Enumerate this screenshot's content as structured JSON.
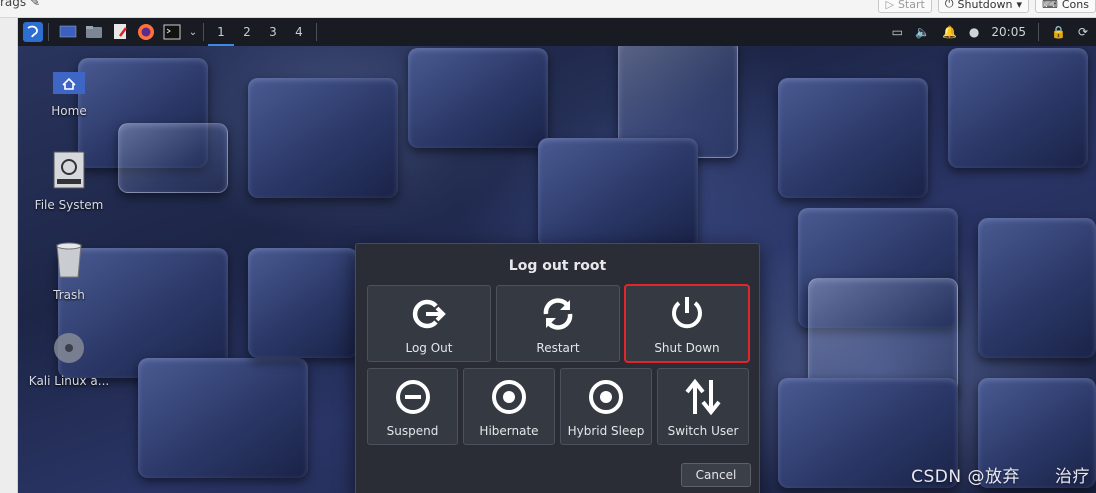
{
  "host": {
    "left_text": "rags",
    "buttons": [
      {
        "label": "Start",
        "light": true
      },
      {
        "label": "Shutdown",
        "light": false
      },
      {
        "label": "Cons",
        "light": false
      }
    ]
  },
  "panel": {
    "workspaces": [
      "1",
      "2",
      "3",
      "4"
    ],
    "active_workspace": "1",
    "clock": "20:05"
  },
  "desktop_icons": [
    {
      "label": "Home",
      "icon": "home-folder-icon"
    },
    {
      "label": "File System",
      "icon": "drive-icon"
    },
    {
      "label": "Trash",
      "icon": "trash-icon"
    },
    {
      "label": "Kali Linux a...",
      "icon": "cd-icon"
    }
  ],
  "dialog": {
    "title": "Log out root",
    "top_actions": [
      {
        "label": "Log Out",
        "icon": "logout-icon"
      },
      {
        "label": "Restart",
        "icon": "restart-icon"
      },
      {
        "label": "Shut Down",
        "icon": "power-icon"
      }
    ],
    "bottom_actions": [
      {
        "label": "Suspend",
        "icon": "suspend-icon"
      },
      {
        "label": "Hibernate",
        "icon": "hibernate-icon"
      },
      {
        "label": "Hybrid Sleep",
        "icon": "hybrid-sleep-icon"
      },
      {
        "label": "Switch User",
        "icon": "switch-user-icon"
      }
    ],
    "cancel_label": "Cancel",
    "highlight_color": "#e0262b"
  },
  "watermark": "CSDN @放弃　　治疗"
}
